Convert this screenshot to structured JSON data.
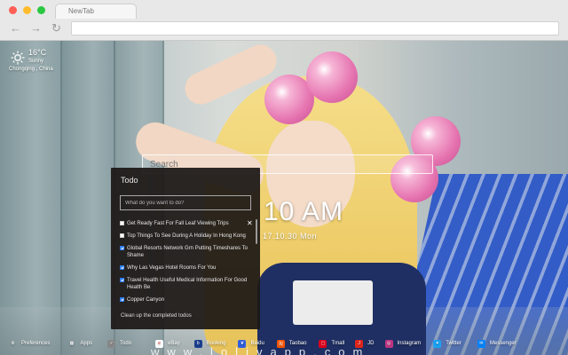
{
  "browser": {
    "tab_title": "NewTab",
    "back": "←",
    "forward": "→",
    "reload": "↻"
  },
  "weather": {
    "temperature": "16°C",
    "condition": "Sunny",
    "location": "Chongqing , China",
    "icon": "sun-icon"
  },
  "search": {
    "label": "Search"
  },
  "clock": {
    "time": "10 AM",
    "date": "17.10.30 Mon"
  },
  "todo": {
    "title": "Todo",
    "placeholder": "What do you want to do?",
    "items": [
      {
        "text": "Get Ready Fast For Fall Leaf Viewing Trips",
        "done": false
      },
      {
        "text": "Top Things To See During A Holiday In Hong Kong",
        "done": false
      },
      {
        "text": "Global Resorts Network Grn Putting Timeshares To Shame",
        "done": true
      },
      {
        "text": "Why Las Vegas Hotel Rooms For You",
        "done": true
      },
      {
        "text": "Travel Health Useful Medical Information For Good Health Be",
        "done": true
      },
      {
        "text": "Copper Canyon",
        "done": true
      }
    ],
    "delete_icon": "✕",
    "clear_label": "Clean up the completed todos"
  },
  "bottom_bar": [
    {
      "label": "Preferences",
      "icon": "gear-icon",
      "color": "transparent",
      "glyph": "⚙"
    },
    {
      "label": "Apps",
      "icon": "grid-icon",
      "color": "transparent",
      "glyph": "▦"
    },
    {
      "label": "Todo",
      "icon": "todo-icon",
      "color": "#888888",
      "glyph": "✓"
    },
    {
      "label": "eBay",
      "icon": "ebay-icon",
      "color": "#ffffff",
      "glyph": "e"
    },
    {
      "label": "Booking",
      "icon": "booking-icon",
      "color": "#1a3f8f",
      "glyph": "b"
    },
    {
      "label": "Baidu",
      "icon": "baidu-icon",
      "color": "#2f5fe0",
      "glyph": "❦"
    },
    {
      "label": "Taobao",
      "icon": "taobao-icon",
      "color": "#ff5500",
      "glyph": "淘"
    },
    {
      "label": "Tmall",
      "icon": "tmall-icon",
      "color": "#e0001b",
      "glyph": "▢"
    },
    {
      "label": "JD",
      "icon": "jd-icon",
      "color": "#e1251b",
      "glyph": "J"
    },
    {
      "label": "Instagram",
      "icon": "instagram-icon",
      "color": "#c13584",
      "glyph": "◎"
    },
    {
      "label": "Twitter",
      "icon": "twitter-icon",
      "color": "#1da1f2",
      "glyph": "✦"
    },
    {
      "label": "Messenger",
      "icon": "messenger-icon",
      "color": "#0084ff",
      "glyph": "✉"
    }
  ],
  "footer": {
    "text": "www.lolivapp.com"
  }
}
